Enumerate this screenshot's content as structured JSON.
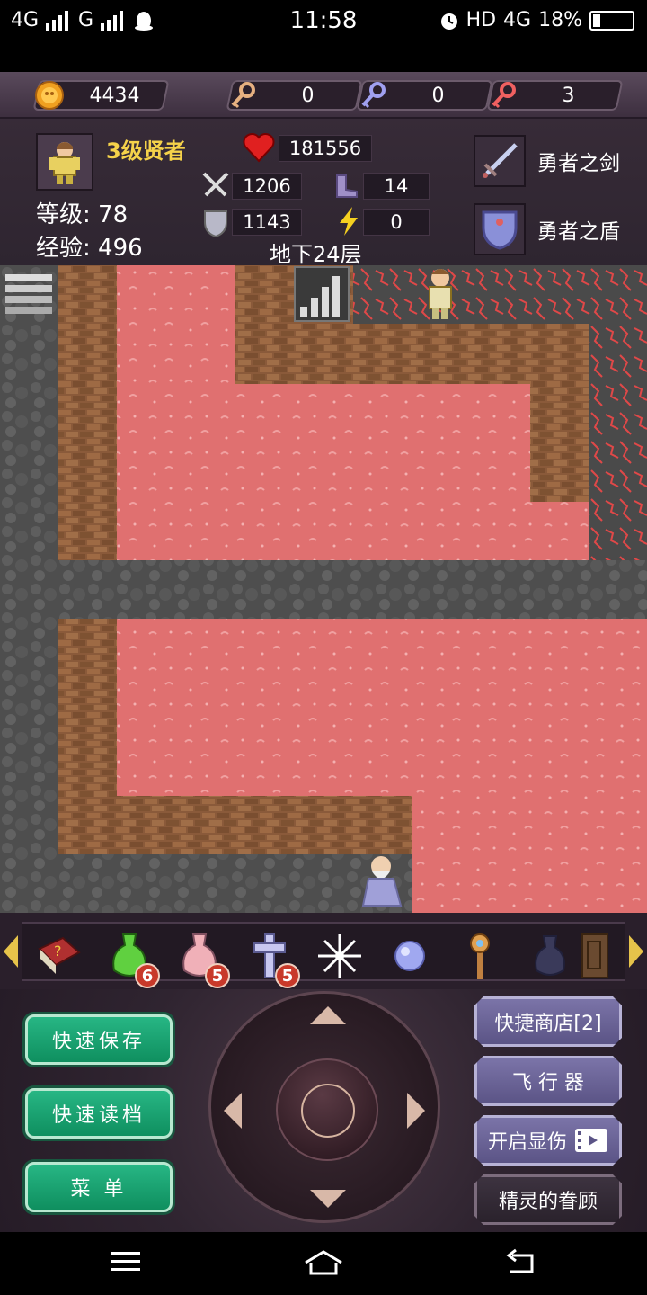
{
  "status_bar": {
    "network_left": "4G",
    "network_mid": "G",
    "time": "11:58",
    "hd": "HD",
    "network_right": "4G",
    "battery": "18%"
  },
  "resources": {
    "gold": "4434",
    "yellow_keys": "0",
    "blue_keys": "0",
    "red_keys": "3"
  },
  "hero": {
    "title": "3级贤者",
    "level_label": "等级:",
    "level": "78",
    "exp_label": "经验:",
    "exp": "496",
    "hp": "181556",
    "attack": "1206",
    "defense": "1143",
    "agility": "14",
    "magic": "0"
  },
  "floor": "地下24层",
  "equipment": {
    "weapon": "勇者之剑",
    "armor": "勇者之盾"
  },
  "items": [
    {
      "icon": "book-icon",
      "count": ""
    },
    {
      "icon": "green-potion-icon",
      "count": "6"
    },
    {
      "icon": "pink-potion-icon",
      "count": "5"
    },
    {
      "icon": "cross-icon",
      "count": "5"
    },
    {
      "icon": "snowflake-icon",
      "count": ""
    },
    {
      "icon": "orb-icon",
      "count": ""
    },
    {
      "icon": "staff-icon",
      "count": ""
    },
    {
      "icon": "dark-vase-icon",
      "count": ""
    },
    {
      "icon": "door-icon",
      "count": ""
    }
  ],
  "buttons": {
    "quick_save": "快速保存",
    "quick_load": "快速读档",
    "menu": "菜 单",
    "quick_shop": "快捷商店[2]",
    "fly": "飞 行 器",
    "show_damage": "开启显伤",
    "fairy": "精灵的眷顾"
  },
  "colors": {
    "lava": "#e07070",
    "brick": "#8a5a3a",
    "stone": "#5a5a5a",
    "gold_text": "#f5d24a"
  }
}
